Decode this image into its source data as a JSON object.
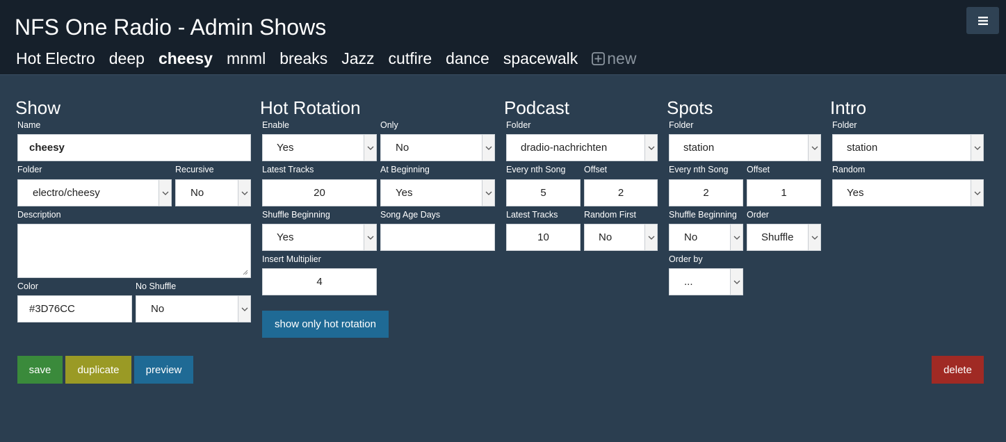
{
  "header": {
    "title": "NFS One Radio - Admin Shows",
    "menu_icon": "hamburger-icon"
  },
  "tabs": [
    {
      "label": "Hot Electro",
      "active": false
    },
    {
      "label": "deep",
      "active": false
    },
    {
      "label": "cheesy",
      "active": true
    },
    {
      "label": "mnml",
      "active": false
    },
    {
      "label": "breaks",
      "active": false
    },
    {
      "label": "Jazz",
      "active": false
    },
    {
      "label": "cutfire",
      "active": false
    },
    {
      "label": "dance",
      "active": false
    },
    {
      "label": "spacewalk",
      "active": false
    }
  ],
  "new_tab": {
    "label": "new",
    "icon": "plus-square-icon"
  },
  "show": {
    "heading": "Show",
    "name_label": "Name",
    "name_value": "cheesy",
    "folder_label": "Folder",
    "folder_value": "electro/cheesy",
    "recursive_label": "Recursive",
    "recursive_value": "No",
    "description_label": "Description",
    "description_value": "",
    "color_label": "Color",
    "color_value": "#3D76CC",
    "no_shuffle_label": "No Shuffle",
    "no_shuffle_value": "No"
  },
  "hot_rotation": {
    "heading": "Hot Rotation",
    "enable_label": "Enable",
    "enable_value": "Yes",
    "only_label": "Only",
    "only_value": "No",
    "latest_tracks_label": "Latest Tracks",
    "latest_tracks_value": "20",
    "at_beginning_label": "At Beginning",
    "at_beginning_value": "Yes",
    "shuffle_beginning_label": "Shuffle Beginning",
    "shuffle_beginning_value": "Yes",
    "song_age_days_label": "Song Age Days",
    "song_age_days_value": "",
    "insert_multiplier_label": "Insert Multiplier",
    "insert_multiplier_value": "4",
    "show_only_button": "show only hot rotation"
  },
  "podcast": {
    "heading": "Podcast",
    "folder_label": "Folder",
    "folder_value": "dradio-nachrichten",
    "every_nth_label": "Every nth Song",
    "every_nth_value": "5",
    "offset_label": "Offset",
    "offset_value": "2",
    "latest_tracks_label": "Latest Tracks",
    "latest_tracks_value": "10",
    "random_first_label": "Random First",
    "random_first_value": "No"
  },
  "spots": {
    "heading": "Spots",
    "folder_label": "Folder",
    "folder_value": "station",
    "every_nth_label": "Every nth Song",
    "every_nth_value": "2",
    "offset_label": "Offset",
    "offset_value": "1",
    "shuffle_beginning_label": "Shuffle Beginning",
    "shuffle_beginning_value": "No",
    "order_label": "Order",
    "order_value": "Shuffle",
    "order_by_label": "Order by",
    "order_by_value": "..."
  },
  "intro": {
    "heading": "Intro",
    "folder_label": "Folder",
    "folder_value": "station",
    "random_label": "Random",
    "random_value": "Yes"
  },
  "actions": {
    "save": "save",
    "duplicate": "duplicate",
    "preview": "preview",
    "delete": "delete"
  },
  "colors": {
    "background": "#2b3e50",
    "topbar": "#16202b",
    "save": "#3a8a3b",
    "duplicate": "#9a9a25",
    "preview": "#1f6a95",
    "delete": "#a02a24"
  }
}
